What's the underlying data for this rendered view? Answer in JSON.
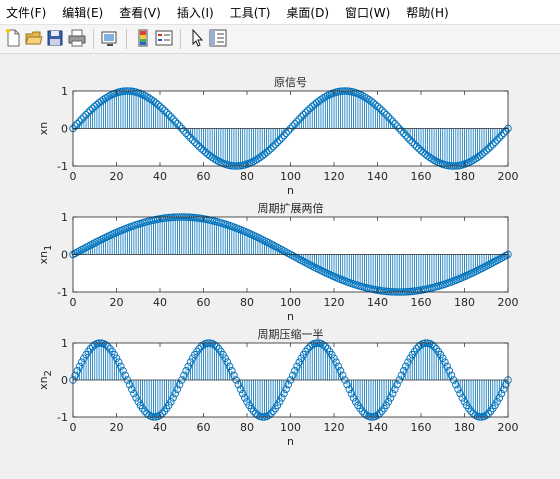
{
  "menubar": {
    "items": [
      "文件(F)",
      "编辑(E)",
      "查看(V)",
      "插入(I)",
      "工具(T)",
      "桌面(D)",
      "窗口(W)",
      "帮助(H)"
    ]
  },
  "toolbar": {
    "icons": [
      "new-file-icon",
      "open-folder-icon",
      "save-icon",
      "print-icon",
      "link-plot-icon",
      "insert-colorbar-icon",
      "insert-legend-icon",
      "pointer-icon",
      "property-inspector-icon"
    ]
  },
  "colors": {
    "stem": "#0072BD",
    "axes": "#262626",
    "background": "#ffffff",
    "figure": "#f0f0f0"
  },
  "chart_data": [
    {
      "type": "stem",
      "title": "原信号",
      "xlabel": "n",
      "ylabel": "xn",
      "ylabel_sub": "",
      "xlim": [
        0,
        200
      ],
      "ylim": [
        -1,
        1
      ],
      "xticks": [
        0,
        20,
        40,
        60,
        80,
        100,
        120,
        140,
        160,
        180,
        200
      ],
      "yticks": [
        -1,
        0,
        1
      ],
      "n_points": 201,
      "period": 100,
      "function": "sin(2*pi*n/100)"
    },
    {
      "type": "stem",
      "title": "周期扩展两倍",
      "xlabel": "n",
      "ylabel": "xn",
      "ylabel_sub": "1",
      "xlim": [
        0,
        200
      ],
      "ylim": [
        -1,
        1
      ],
      "xticks": [
        0,
        20,
        40,
        60,
        80,
        100,
        120,
        140,
        160,
        180,
        200
      ],
      "yticks": [
        -1,
        0,
        1
      ],
      "n_points": 201,
      "period": 200,
      "function": "sin(2*pi*n/200)"
    },
    {
      "type": "stem",
      "title": "周期压缩一半",
      "xlabel": "n",
      "ylabel": "xn",
      "ylabel_sub": "2",
      "xlim": [
        0,
        200
      ],
      "ylim": [
        -1,
        1
      ],
      "xticks": [
        0,
        20,
        40,
        60,
        80,
        100,
        120,
        140,
        160,
        180,
        200
      ],
      "yticks": [
        -1,
        0,
        1
      ],
      "n_points": 201,
      "period": 50,
      "function": "sin(2*pi*n/50)"
    }
  ]
}
